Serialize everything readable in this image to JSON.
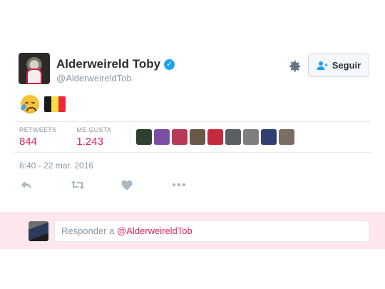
{
  "user": {
    "name": "Alderweireld Toby",
    "handle": "@AlderweireldTob",
    "verified": true,
    "follow_label": "Seguir"
  },
  "tweet": {
    "content_emojis": [
      "crying-face",
      "belgium-flag"
    ],
    "timestamp": "6:40 - 22 mar. 2016"
  },
  "stats": {
    "retweets_label": "RETWEETS",
    "retweets_value": "844",
    "likes_label": "ME GUSTA",
    "likes_value": "1.243"
  },
  "likers": [
    {
      "color": "#2d3f2f"
    },
    {
      "color": "#7b4fa3"
    },
    {
      "color": "#b63a58"
    },
    {
      "color": "#6a5848"
    },
    {
      "color": "#c52a3d"
    },
    {
      "color": "#5b5f63"
    },
    {
      "color": "#7f7f7f"
    },
    {
      "color": "#303f6f"
    },
    {
      "color": "#7b6e62"
    }
  ],
  "reply": {
    "prefix": "Responder a ",
    "mention": "@AlderweireldTob"
  },
  "colors": {
    "accent_pink": "#e0245e",
    "muted_text": "#8899a6",
    "reply_bg": "#fde7ec",
    "verified_blue": "#1da1f2"
  }
}
